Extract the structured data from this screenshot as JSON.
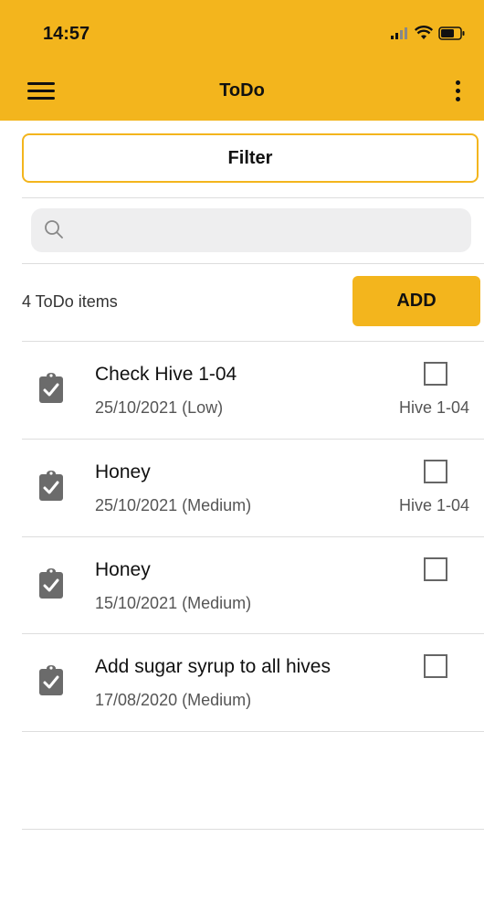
{
  "status_bar": {
    "time": "14:57"
  },
  "app_bar": {
    "title": "ToDo"
  },
  "filter": {
    "label": "Filter"
  },
  "search": {
    "placeholder": ""
  },
  "list_header": {
    "count_text": "4 ToDo items",
    "add_label": "ADD"
  },
  "items": [
    {
      "name": "Check Hive 1-04",
      "date": "25/10/2021 (Low)",
      "hive": "Hive 1-04",
      "checked": false
    },
    {
      "name": "Honey",
      "date": "25/10/2021 (Medium)",
      "hive": "Hive 1-04",
      "checked": false
    },
    {
      "name": "Honey",
      "date": "15/10/2021 (Medium)",
      "hive": "",
      "checked": false
    },
    {
      "name": "Add sugar syrup to all hives",
      "date": "17/08/2020 (Medium)",
      "hive": "",
      "checked": false
    }
  ],
  "icons": {
    "menu": "hamburger-icon",
    "more": "more-vertical-icon",
    "search": "search-icon",
    "item": "clipboard-check-icon"
  },
  "colors": {
    "accent": "#f3b51d",
    "icon_gray": "#6b6b6b"
  }
}
